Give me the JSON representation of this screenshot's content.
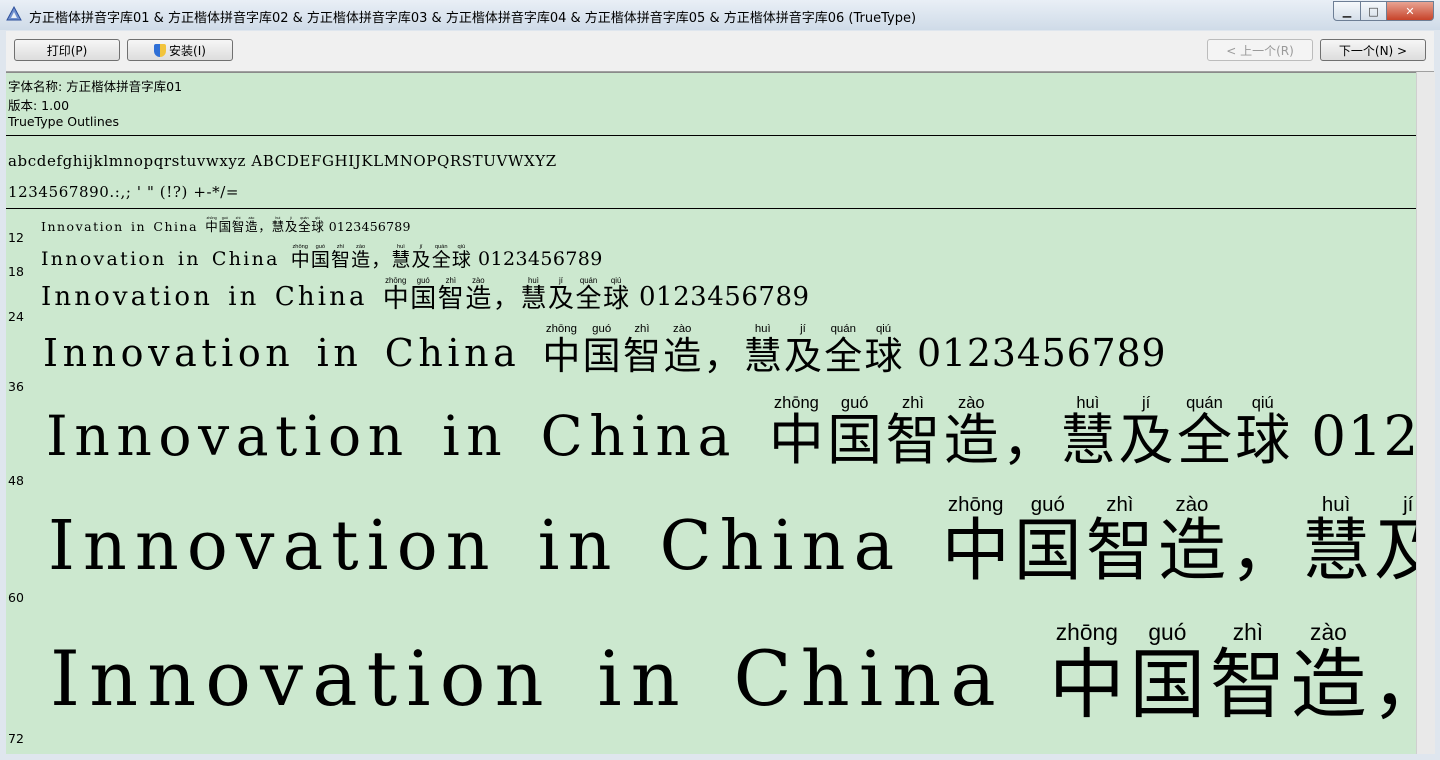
{
  "window": {
    "title": "方正楷体拼音字库01 & 方正楷体拼音字库02 & 方正楷体拼音字库03 & 方正楷体拼音字库04 & 方正楷体拼音字库05 & 方正楷体拼音字库06 (TrueType)",
    "controls": {
      "minimize": "▁",
      "maximize": "□",
      "close": "✕"
    }
  },
  "toolbar": {
    "print_label": "打印(P)",
    "install_label": "安装(I)",
    "prev_label": "< 上一个(R)",
    "next_label": "下一个(N) >"
  },
  "font_info": {
    "name_line": "字体名称: 方正楷体拼音字库01",
    "version_line": "版本: 1.00",
    "type_line": "TrueType Outlines"
  },
  "char_samples": {
    "letters": "abcdefghijklmnopqrstuvwxyz ABCDEFGHIJKLMNOPQRSTUVWXYZ",
    "digits_punct": "1234567890.:,; ' \" (!?) +-*/="
  },
  "sample_text": {
    "latin": "Innovation in China",
    "digits": "0123456789",
    "cjk": [
      {
        "char": "中",
        "pinyin": "zhōng"
      },
      {
        "char": "国",
        "pinyin": "guó"
      },
      {
        "char": "智",
        "pinyin": "zhì"
      },
      {
        "char": "造",
        "pinyin": "zào"
      },
      {
        "char": "，",
        "pinyin": ""
      },
      {
        "char": "慧",
        "pinyin": "huì"
      },
      {
        "char": "及",
        "pinyin": "jí"
      },
      {
        "char": "全",
        "pinyin": "quán"
      },
      {
        "char": "球",
        "pinyin": "qiú"
      }
    ]
  },
  "sizes": [
    "12",
    "18",
    "24",
    "36",
    "48",
    "60",
    "72"
  ],
  "colors": {
    "content_bg": "#cce8cf",
    "text": "#000000"
  },
  "icons": {
    "app": "font-viewer-icon",
    "install": "uac-shield-icon"
  }
}
